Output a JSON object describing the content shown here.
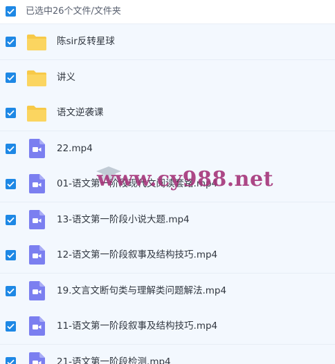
{
  "header": {
    "selection_text": "已选中26个文件/文件夹"
  },
  "colors": {
    "checkbox": "#1e88e5",
    "folder": "#f7c948",
    "video": "#7b7ff0",
    "watermark": "#a5347a"
  },
  "items": [
    {
      "name": "陈sir反转星球",
      "icon": "folder-icon",
      "checked": true
    },
    {
      "name": "讲义",
      "icon": "folder-icon",
      "checked": true
    },
    {
      "name": "语文逆袭课",
      "icon": "folder-icon",
      "checked": true
    },
    {
      "name": "22.mp4",
      "icon": "video-file-icon",
      "checked": true
    },
    {
      "name": "01-语文第一阶段现代文阅读套路.mp4",
      "icon": "video-file-icon",
      "checked": true
    },
    {
      "name": "13-语文第一阶段小说大题.mp4",
      "icon": "video-file-icon",
      "checked": true
    },
    {
      "name": "12-语文第一阶段叙事及结构技巧.mp4",
      "icon": "video-file-icon",
      "checked": true
    },
    {
      "name": "19.文言文断句类与理解类问题解法.mp4",
      "icon": "video-file-icon",
      "checked": true
    },
    {
      "name": "11-语文第一阶段叙事及结构技巧.mp4",
      "icon": "video-file-icon",
      "checked": true
    },
    {
      "name": "21-语文第一阶段检测.mp4",
      "icon": "video-file-icon",
      "checked": true
    }
  ],
  "watermark": {
    "text": "www.cy988.net"
  }
}
